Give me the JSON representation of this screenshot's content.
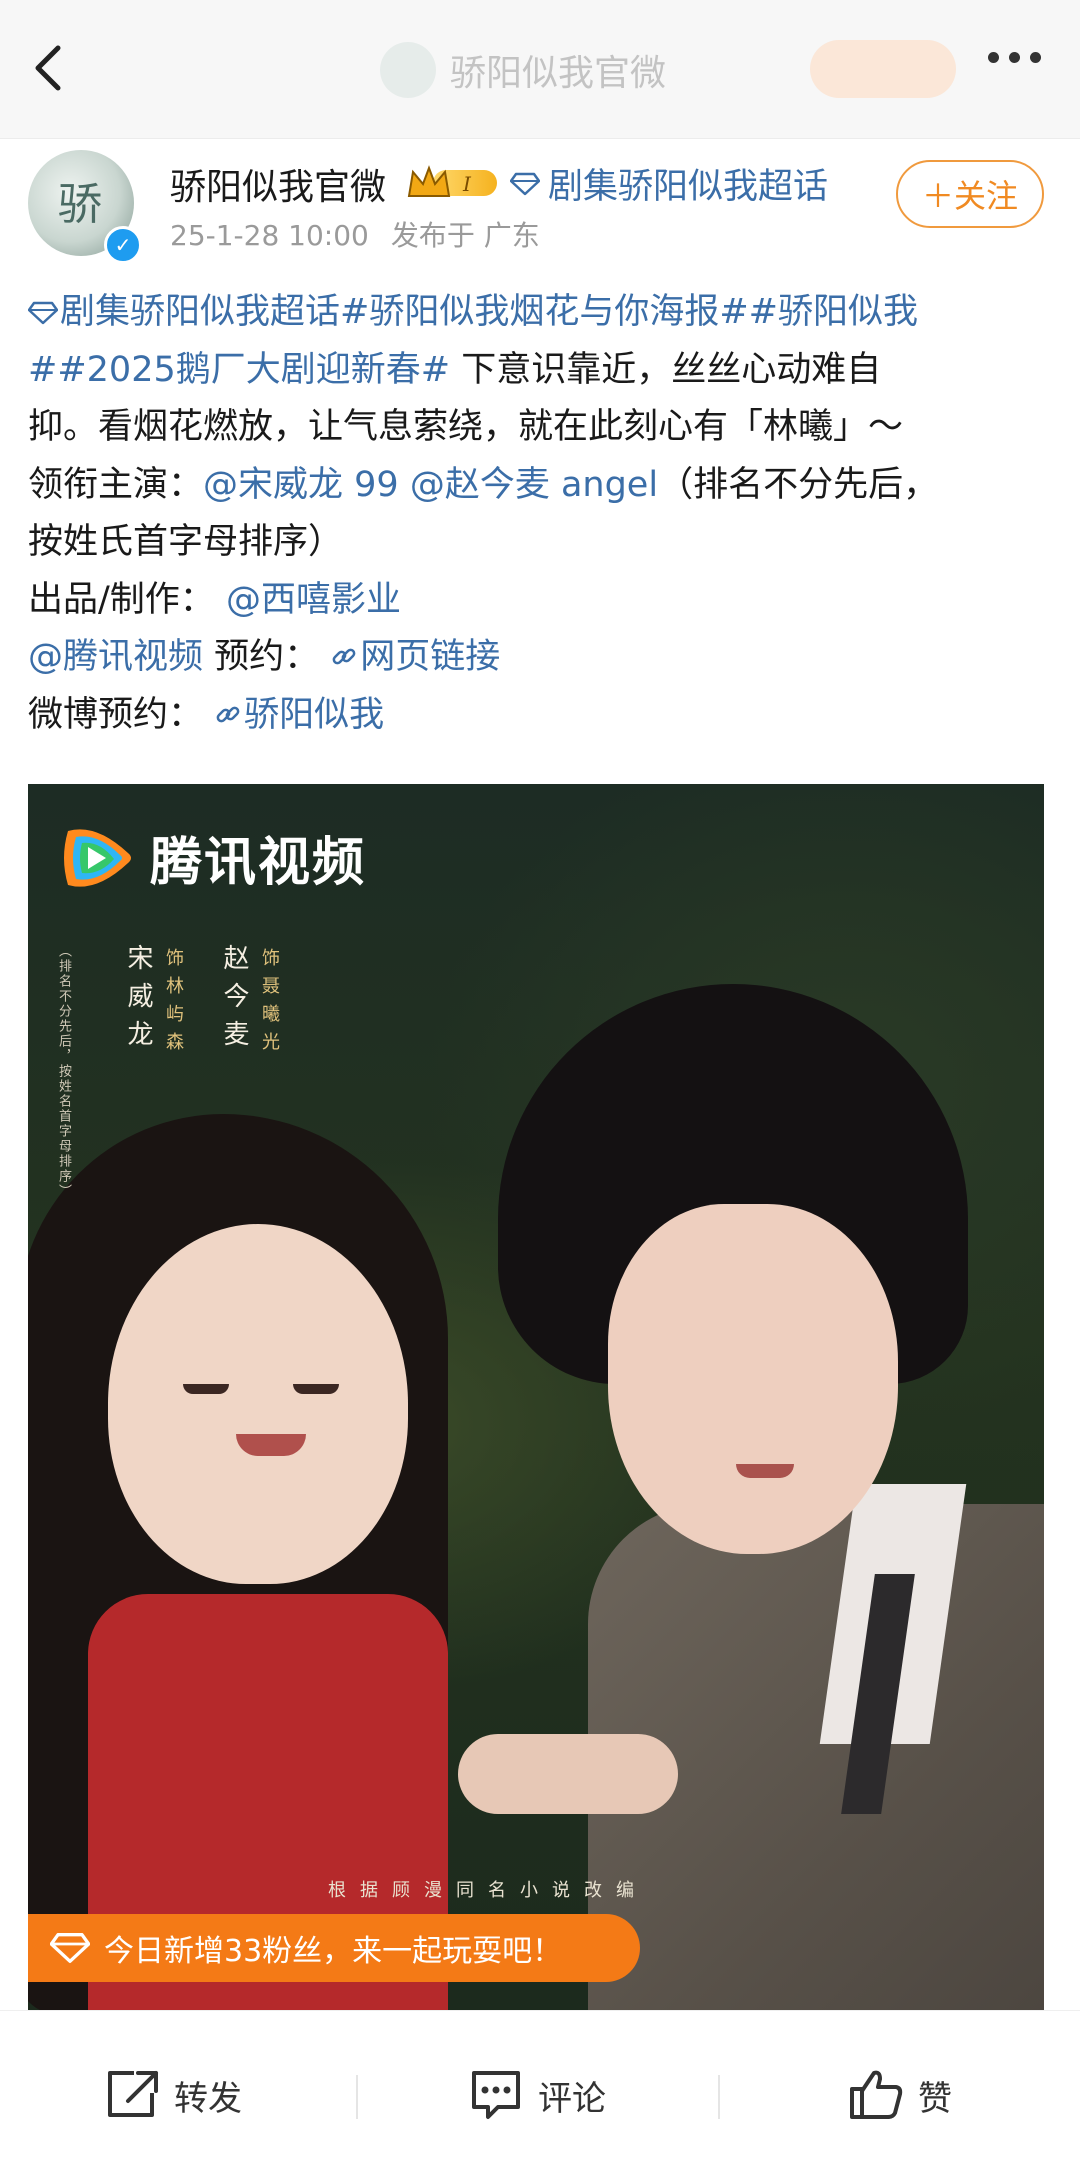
{
  "nav": {
    "title": "骄阳似我官微",
    "back_icon": "back-arrow-icon",
    "more_icon": "more-dots-icon"
  },
  "author": {
    "name": "骄阳似我官微",
    "badge_level": "I",
    "super_topic": "剧集骄阳似我超话",
    "time": "25-1-28 10:00",
    "location": "发布于 广东",
    "follow_label": "＋关注",
    "avatar_glyph": "骄"
  },
  "post": {
    "line1": {
      "topic_main": "剧集骄阳似我超话",
      "tags": "#骄阳似我烟花与你海报##骄阳似我"
    },
    "line2": {
      "tag": "##2025鹅厂大剧迎新春#",
      "text": " 下意识靠近，丝丝心动难自"
    },
    "line3": "抑。看烟花燃放，让气息萦绕，就在此刻心有「林曦」～",
    "line4": {
      "label": "领衔主演：",
      "mention1": "@宋威龙 99",
      "mention2": "@赵今麦 angel",
      "tail": "（排名不分先后，"
    },
    "line5": "按姓氏首字母排序）",
    "line6": {
      "label": "出品/制作：",
      "mention": "@西嘻影业"
    },
    "line7": {
      "mention": "@腾讯视频",
      "label": " 预约：",
      "link": "网页链接"
    },
    "line8": {
      "label": "微博预约：",
      "link": "骄阳似我"
    }
  },
  "poster": {
    "brand": "腾讯视频",
    "actor1": "宋威龙",
    "role1": "饰林屿森",
    "actor2": "赵今麦",
    "role2": "饰聂曦光",
    "ordering_note": "（排名不分先后，按姓名首字母排序）",
    "adaptation": "根据顾漫同名小说改编",
    "fan_banner": "今日新增33粉丝，来一起玩耍吧！"
  },
  "actions": {
    "repost": "转发",
    "comment": "评论",
    "like": "赞"
  },
  "colors": {
    "link": "#3b6ea8",
    "accent_orange": "#f08a22",
    "banner_orange": "#f47a16",
    "verified_blue": "#1e9cf0"
  }
}
